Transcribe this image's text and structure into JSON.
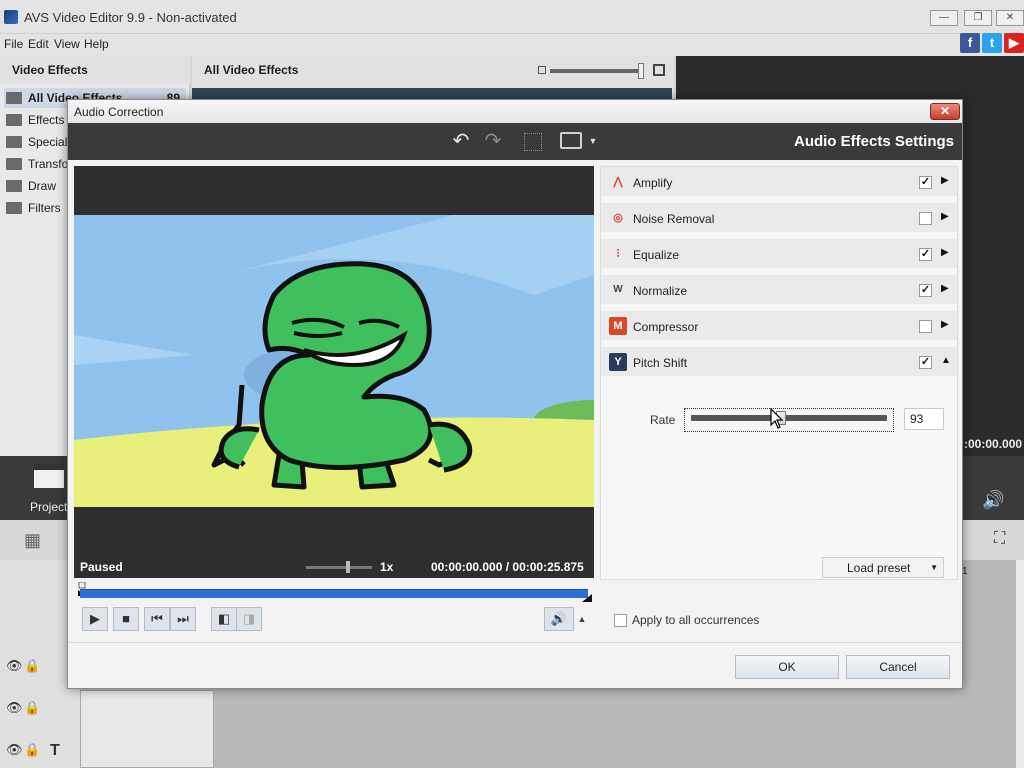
{
  "app": {
    "title": "AVS Video Editor 9.9 - Non-activated",
    "menu": [
      "File",
      "Edit",
      "View",
      "Help"
    ],
    "window_buttons": [
      "minimize",
      "restore",
      "close"
    ]
  },
  "left_panel": {
    "header": "Video Effects",
    "count": "89",
    "items": [
      {
        "label": "All Video Effects",
        "selected": true
      },
      {
        "label": "Effects"
      },
      {
        "label": "Special"
      },
      {
        "label": "Transfo"
      },
      {
        "label": "Draw"
      },
      {
        "label": "Filters"
      }
    ]
  },
  "center_panel": {
    "title": "All Video Effects"
  },
  "background": {
    "timecode": ":00:00.000",
    "project_label": "Project",
    "timeline_tick": "1"
  },
  "dialog": {
    "title": "Audio Correction",
    "close_glyph": "✕",
    "heading": "Audio Effects Settings",
    "toolbar_icons": [
      "undo-icon",
      "redo-icon",
      "grid-icon",
      "monitor-icon",
      "dropdown-arrow-icon"
    ],
    "status": "Paused",
    "speed": "1x",
    "time": "00:00:00.000  /  00:00:25.875",
    "effects": [
      {
        "label": "Amplify",
        "checked": true,
        "expanded": false,
        "icon": "amplify-icon"
      },
      {
        "label": "Noise Removal",
        "checked": false,
        "expanded": false,
        "icon": "noise-removal-icon"
      },
      {
        "label": "Equalize",
        "checked": true,
        "expanded": false,
        "icon": "equalize-icon"
      },
      {
        "label": "Normalize",
        "checked": true,
        "expanded": false,
        "icon": "normalize-icon"
      },
      {
        "label": "Compressor",
        "checked": false,
        "expanded": false,
        "icon": "compressor-icon"
      },
      {
        "label": "Pitch Shift",
        "checked": true,
        "expanded": true,
        "icon": "pitch-shift-icon"
      }
    ],
    "rate": {
      "label": "Rate",
      "value": "93",
      "slider_fraction": 0.46
    },
    "load_preset": "Load preset",
    "apply_all": {
      "label": "Apply to all occurrences",
      "checked": false
    },
    "ok": "OK",
    "cancel": "Cancel"
  },
  "colors": {
    "dialog_toolbar": "#3a3a3a",
    "scrub_bar": "#2b6fd6",
    "close_button": "#c4402b",
    "sky": "#8fc3ee",
    "ground": "#e8ef7a",
    "character": "#3fbf5e"
  }
}
